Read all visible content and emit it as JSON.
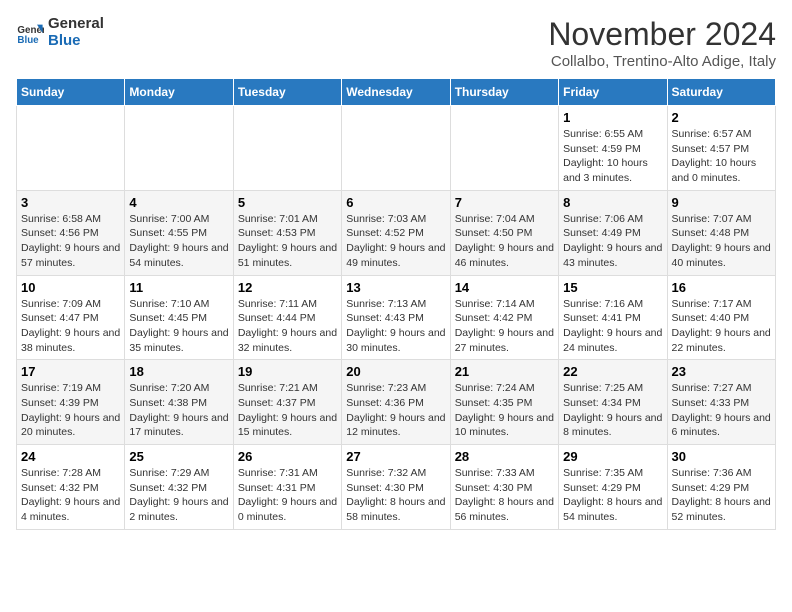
{
  "logo": {
    "line1": "General",
    "line2": "Blue"
  },
  "title": "November 2024",
  "subtitle": "Collalbo, Trentino-Alto Adige, Italy",
  "days_of_week": [
    "Sunday",
    "Monday",
    "Tuesday",
    "Wednesday",
    "Thursday",
    "Friday",
    "Saturday"
  ],
  "weeks": [
    [
      {
        "day": "",
        "info": ""
      },
      {
        "day": "",
        "info": ""
      },
      {
        "day": "",
        "info": ""
      },
      {
        "day": "",
        "info": ""
      },
      {
        "day": "",
        "info": ""
      },
      {
        "day": "1",
        "info": "Sunrise: 6:55 AM\nSunset: 4:59 PM\nDaylight: 10 hours and 3 minutes."
      },
      {
        "day": "2",
        "info": "Sunrise: 6:57 AM\nSunset: 4:57 PM\nDaylight: 10 hours and 0 minutes."
      }
    ],
    [
      {
        "day": "3",
        "info": "Sunrise: 6:58 AM\nSunset: 4:56 PM\nDaylight: 9 hours and 57 minutes."
      },
      {
        "day": "4",
        "info": "Sunrise: 7:00 AM\nSunset: 4:55 PM\nDaylight: 9 hours and 54 minutes."
      },
      {
        "day": "5",
        "info": "Sunrise: 7:01 AM\nSunset: 4:53 PM\nDaylight: 9 hours and 51 minutes."
      },
      {
        "day": "6",
        "info": "Sunrise: 7:03 AM\nSunset: 4:52 PM\nDaylight: 9 hours and 49 minutes."
      },
      {
        "day": "7",
        "info": "Sunrise: 7:04 AM\nSunset: 4:50 PM\nDaylight: 9 hours and 46 minutes."
      },
      {
        "day": "8",
        "info": "Sunrise: 7:06 AM\nSunset: 4:49 PM\nDaylight: 9 hours and 43 minutes."
      },
      {
        "day": "9",
        "info": "Sunrise: 7:07 AM\nSunset: 4:48 PM\nDaylight: 9 hours and 40 minutes."
      }
    ],
    [
      {
        "day": "10",
        "info": "Sunrise: 7:09 AM\nSunset: 4:47 PM\nDaylight: 9 hours and 38 minutes."
      },
      {
        "day": "11",
        "info": "Sunrise: 7:10 AM\nSunset: 4:45 PM\nDaylight: 9 hours and 35 minutes."
      },
      {
        "day": "12",
        "info": "Sunrise: 7:11 AM\nSunset: 4:44 PM\nDaylight: 9 hours and 32 minutes."
      },
      {
        "day": "13",
        "info": "Sunrise: 7:13 AM\nSunset: 4:43 PM\nDaylight: 9 hours and 30 minutes."
      },
      {
        "day": "14",
        "info": "Sunrise: 7:14 AM\nSunset: 4:42 PM\nDaylight: 9 hours and 27 minutes."
      },
      {
        "day": "15",
        "info": "Sunrise: 7:16 AM\nSunset: 4:41 PM\nDaylight: 9 hours and 24 minutes."
      },
      {
        "day": "16",
        "info": "Sunrise: 7:17 AM\nSunset: 4:40 PM\nDaylight: 9 hours and 22 minutes."
      }
    ],
    [
      {
        "day": "17",
        "info": "Sunrise: 7:19 AM\nSunset: 4:39 PM\nDaylight: 9 hours and 20 minutes."
      },
      {
        "day": "18",
        "info": "Sunrise: 7:20 AM\nSunset: 4:38 PM\nDaylight: 9 hours and 17 minutes."
      },
      {
        "day": "19",
        "info": "Sunrise: 7:21 AM\nSunset: 4:37 PM\nDaylight: 9 hours and 15 minutes."
      },
      {
        "day": "20",
        "info": "Sunrise: 7:23 AM\nSunset: 4:36 PM\nDaylight: 9 hours and 12 minutes."
      },
      {
        "day": "21",
        "info": "Sunrise: 7:24 AM\nSunset: 4:35 PM\nDaylight: 9 hours and 10 minutes."
      },
      {
        "day": "22",
        "info": "Sunrise: 7:25 AM\nSunset: 4:34 PM\nDaylight: 9 hours and 8 minutes."
      },
      {
        "day": "23",
        "info": "Sunrise: 7:27 AM\nSunset: 4:33 PM\nDaylight: 9 hours and 6 minutes."
      }
    ],
    [
      {
        "day": "24",
        "info": "Sunrise: 7:28 AM\nSunset: 4:32 PM\nDaylight: 9 hours and 4 minutes."
      },
      {
        "day": "25",
        "info": "Sunrise: 7:29 AM\nSunset: 4:32 PM\nDaylight: 9 hours and 2 minutes."
      },
      {
        "day": "26",
        "info": "Sunrise: 7:31 AM\nSunset: 4:31 PM\nDaylight: 9 hours and 0 minutes."
      },
      {
        "day": "27",
        "info": "Sunrise: 7:32 AM\nSunset: 4:30 PM\nDaylight: 8 hours and 58 minutes."
      },
      {
        "day": "28",
        "info": "Sunrise: 7:33 AM\nSunset: 4:30 PM\nDaylight: 8 hours and 56 minutes."
      },
      {
        "day": "29",
        "info": "Sunrise: 7:35 AM\nSunset: 4:29 PM\nDaylight: 8 hours and 54 minutes."
      },
      {
        "day": "30",
        "info": "Sunrise: 7:36 AM\nSunset: 4:29 PM\nDaylight: 8 hours and 52 minutes."
      }
    ]
  ]
}
